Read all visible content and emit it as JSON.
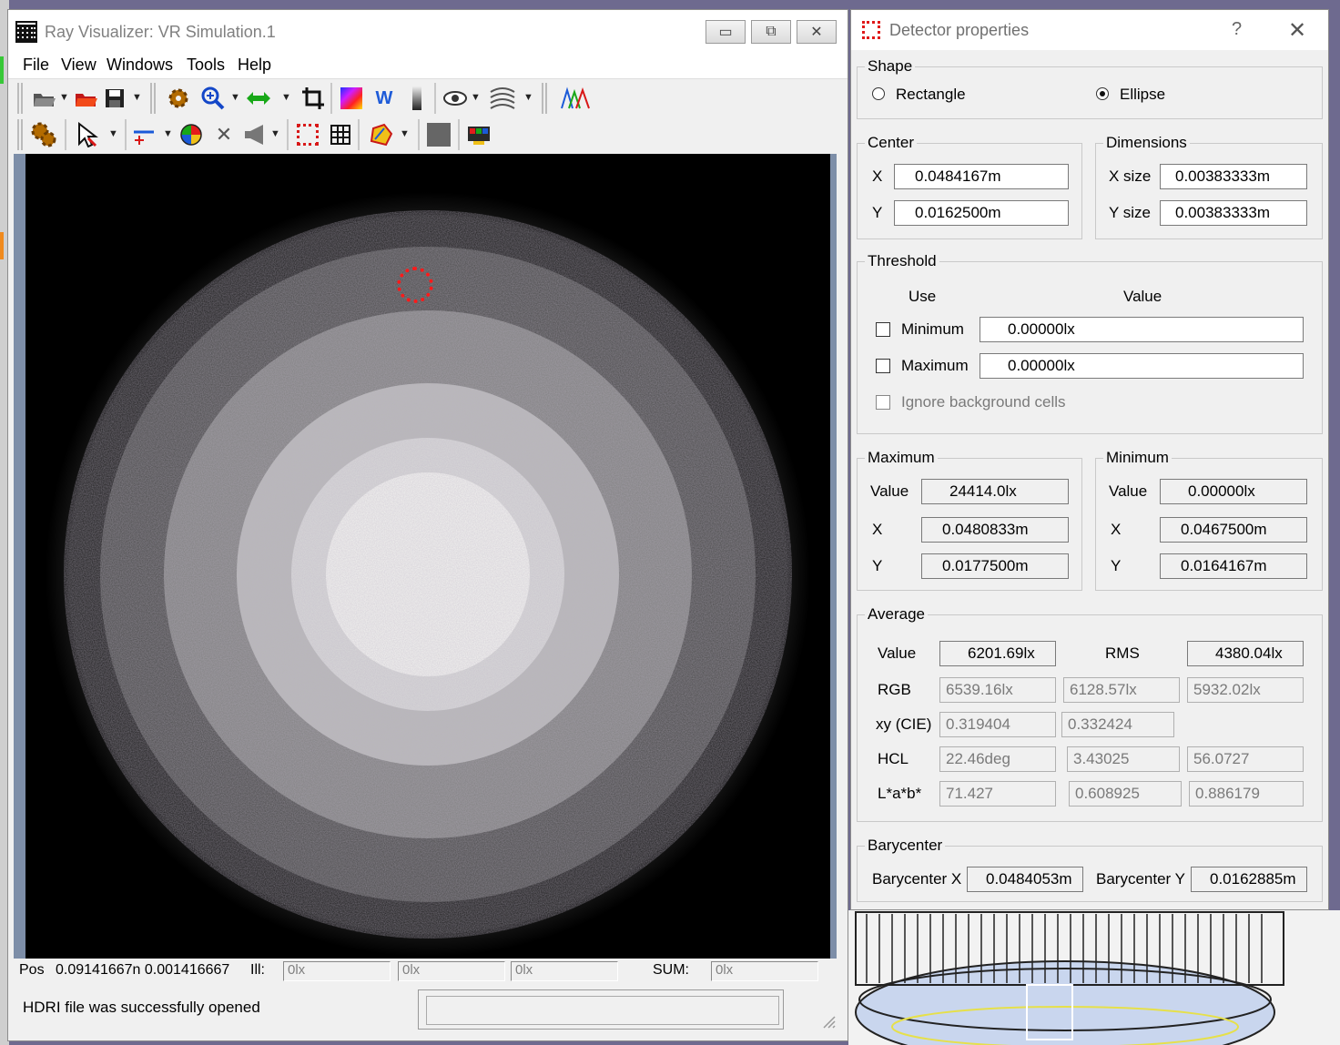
{
  "main_window": {
    "title": "Ray Visualizer: VR Simulation.1",
    "controls": {
      "minimize": "▭",
      "restore": "⧉",
      "close": "✕"
    },
    "menu": [
      "File",
      "View",
      "Windows",
      "Tools",
      "Help"
    ],
    "toolbar1_icons": [
      "open-icon",
      "open-red-icon",
      "save-icon",
      "gear-icon",
      "zoom-in-icon",
      "pan-horizontal-icon",
      "crop-icon",
      "color-map-icon",
      "white-balance-icon",
      "grayscale-bar-icon",
      "eye-icon",
      "noise-icon",
      "spectrum-icon"
    ],
    "toolbar2_icons": [
      "gears-icon",
      "select-pointer-icon",
      "line-icon",
      "color-wheel-icon",
      "cross-icon",
      "megaphone-icon",
      "detector-icon",
      "grid-icon",
      "polygon-icon",
      "square-icon",
      "export-icon"
    ],
    "status": {
      "pos_label": "Pos",
      "pos_value": "0.09141667n  0.001416667",
      "ill_label": "Ill:",
      "ill_values": [
        "0lx",
        "0lx",
        "0lx"
      ],
      "sum_label": "SUM:",
      "sum_value": "0lx",
      "message": "HDRI file was successfully opened"
    }
  },
  "detector_dialog": {
    "title": "Detector properties",
    "help": "?",
    "close": "✕",
    "shape": {
      "legend": "Shape",
      "options": [
        "Rectangle",
        "Ellipse"
      ],
      "selected": "Ellipse"
    },
    "center": {
      "legend": "Center",
      "x_label": "X",
      "x": "0.0484167m",
      "y_label": "Y",
      "y": "0.0162500m"
    },
    "dimensions": {
      "legend": "Dimensions",
      "x_label": "X size",
      "x": "0.00383333m",
      "y_label": "Y size",
      "y": "0.00383333m"
    },
    "threshold": {
      "legend": "Threshold",
      "use_header": "Use",
      "value_header": "Value",
      "minimum_label": "Minimum",
      "minimum_value": "0.00000lx",
      "maximum_label": "Maximum",
      "maximum_value": "0.00000lx",
      "ignore_label": "Ignore background cells"
    },
    "maximum": {
      "legend": "Maximum",
      "value_label": "Value",
      "value": "24414.0lx",
      "x_label": "X",
      "x": "0.0480833m",
      "y_label": "Y",
      "y": "0.0177500m"
    },
    "minimum": {
      "legend": "Minimum",
      "value_label": "Value",
      "value": "0.00000lx",
      "x_label": "X",
      "x": "0.0467500m",
      "y_label": "Y",
      "y": "0.0164167m"
    },
    "average": {
      "legend": "Average",
      "value_label": "Value",
      "value": "6201.69lx",
      "rms_label": "RMS",
      "rms": "4380.04lx",
      "rgb_label": "RGB",
      "rgb": [
        "6539.16lx",
        "6128.57lx",
        "5932.02lx"
      ],
      "xy_label": "xy (CIE)",
      "xy": [
        "0.319404",
        "0.332424"
      ],
      "hcl_label": "HCL",
      "hcl": [
        "22.46deg",
        "3.43025",
        "56.0727"
      ],
      "lab_label": "L*a*b*",
      "lab": [
        "71.427",
        "0.608925",
        "0.886179"
      ]
    },
    "barycenter": {
      "legend": "Barycenter",
      "x_label": "Barycenter X",
      "x": "0.0484053m",
      "y_label": "Barycenter Y",
      "y": "0.0162885m"
    }
  }
}
